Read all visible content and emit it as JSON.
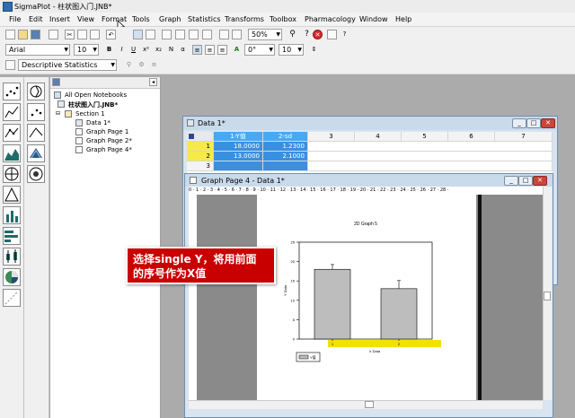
{
  "window": {
    "title": "SigmaPlot - 柱状图入门.JNB*"
  },
  "menu": [
    "File",
    "Edit",
    "Insert",
    "View",
    "Format",
    "Tools",
    "Graph",
    "Statistics",
    "Transforms",
    "Toolbox",
    "Pharmacology",
    "Window",
    "Help"
  ],
  "toolbar": {
    "zoom": "50%"
  },
  "formatbar": {
    "font": "Arial",
    "size": "10",
    "angle": "0°",
    "line_size": "10"
  },
  "statsbar": {
    "test": "Descriptive Statistics"
  },
  "notebook": {
    "root": "All Open Notebooks",
    "file": "柱状图入门.JNB*",
    "section": "Section 1",
    "items": [
      "Data 1*",
      "Graph Page 1",
      "Graph Page 2*",
      "Graph Page 4*"
    ]
  },
  "datasheet": {
    "title": "Data 1*",
    "columns": [
      "1-Y值",
      "2-sd",
      "3",
      "4",
      "5",
      "6",
      "7"
    ],
    "rows": [
      {
        "n": "1",
        "cells": [
          "18.0000",
          "1.2300"
        ]
      },
      {
        "n": "2",
        "cells": [
          "13.0000",
          "2.1000"
        ]
      },
      {
        "n": "3",
        "cells": [
          "",
          ""
        ]
      }
    ]
  },
  "graphwin": {
    "title": "Graph Page 4 - Data 1*",
    "ruler": "0 · 1 · 2 · 3 · 4 · 5 · 6 · 7 · 8 · 9 · 10 · 11 · 12 · 13 · 14 · 15 · 16 · 17 · 18 · 19 · 20 · 21 · 22 · 23 · 24 · 25 · 26 · 27 · 28 ·"
  },
  "chart_data": {
    "type": "bar",
    "title": "2D Graph 5",
    "xlabel": "X Data",
    "ylabel": "Y Data",
    "categories": [
      "1",
      "2"
    ],
    "values": [
      18.0,
      13.0
    ],
    "errors": [
      1.23,
      2.1
    ],
    "ylim": [
      0,
      25
    ],
    "yticks": [
      "0",
      "5",
      "10",
      "15",
      "20",
      "25"
    ],
    "legend": "Y值",
    "bar_color": "#bdbdbd",
    "highlight_color": "#f5e000"
  },
  "callout": {
    "line1": "选择single Y，将用前面",
    "line2": "的序号作为X值",
    "color": "#c80000"
  }
}
